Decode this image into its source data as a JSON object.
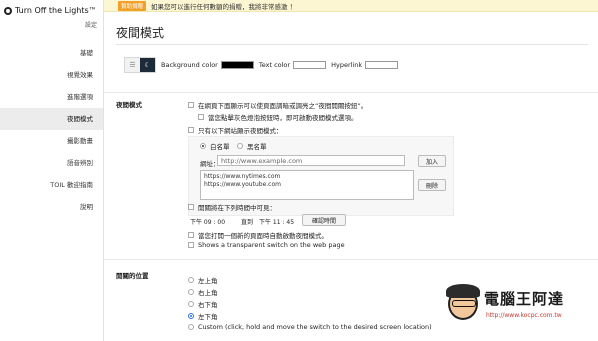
{
  "app": {
    "title": "Turn Off the Lights™",
    "settings_label": "設定"
  },
  "sidebar": {
    "items": [
      {
        "label": "基礎"
      },
      {
        "label": "視覺效果"
      },
      {
        "label": "進階選項"
      },
      {
        "label": "夜間模式",
        "active": true
      },
      {
        "label": "攝影動畫"
      },
      {
        "label": "語音辨別"
      },
      {
        "label": "TOIL 歡迎指南"
      },
      {
        "label": "說明"
      }
    ]
  },
  "notice": {
    "badge": "贊助捐贈",
    "text": "如果您可以進行任何數額的捐贈，我將非常感激 ！"
  },
  "page": {
    "title": "夜間模式"
  },
  "colors": {
    "background_label": "Background color",
    "background_value": "#000000",
    "text_label": "Text color",
    "text_value": "#ffffff",
    "hyperlink_label": "Hyperlink",
    "hyperlink_value": "#ffffff"
  },
  "night_mode": {
    "section_label": "夜間模式",
    "opt_switch": "在網頁下面顯示可以使頁面調暗或調亮之“夜間開關按鈕”。",
    "opt_longpress": "當您點擊灰色燈泡按鈕時，即可啟動夜間模式選項。",
    "opt_sites_only": "只有以下網站顯示夜間模式：",
    "whitelist": "白名單",
    "blacklist": "黑名單",
    "url_label": "網址：",
    "url_placeholder": "http://www.example.com",
    "add_button": "加入",
    "remove_button": "刪除",
    "sites": [
      "https://www.nytimes.com",
      "https://www.youtube.com"
    ],
    "opt_time": "開關將在下列時間中可見：",
    "time_from": "下午 09 : 00",
    "time_to_label": "直到",
    "time_to": "下午 11 : 45",
    "confirm_time": "確認時間",
    "opt_new_page": "當您打開一個新的頁面時自動啟動夜間模式。",
    "opt_transparent": "Shows a transparent switch on the web page"
  },
  "switch_position": {
    "section_label": "開關的位置",
    "options": [
      {
        "label": "左上角"
      },
      {
        "label": "右上角"
      },
      {
        "label": "右下角"
      },
      {
        "label": "左下角",
        "selected": true
      },
      {
        "label": "Custom (click, hold and move the switch to the desired screen location)"
      }
    ]
  },
  "watermark": {
    "title": "電腦王阿達",
    "url": "http://www.kocpc.com.tw"
  },
  "icons": {
    "menu": "hamburger-icon",
    "moon": "moon-icon"
  }
}
